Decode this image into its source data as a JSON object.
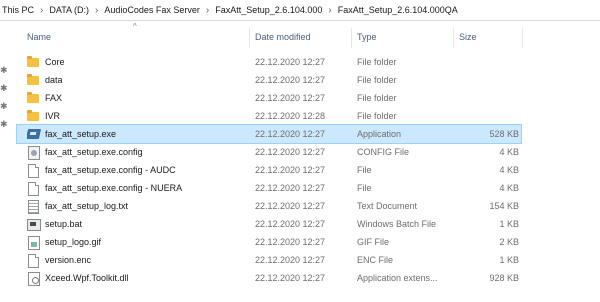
{
  "breadcrumb": [
    "This PC",
    "DATA (D:)",
    "AudioCodes Fax Server",
    "FaxAtt_Setup_2.6.104.000",
    "FaxAtt_Setup_2.6.104.000QA"
  ],
  "breadcrumb_separator": "›",
  "header": {
    "name": "Name",
    "date_modified": "Date modified",
    "type": "Type",
    "size": "Size",
    "sort_indicator": "^"
  },
  "pin_glyph": "✱",
  "files": [
    {
      "icon": "folder-icon",
      "name": "Core",
      "date": "22.12.2020 12:27",
      "type": "File folder",
      "size": ""
    },
    {
      "icon": "folder-icon",
      "name": "data",
      "date": "22.12.2020 12:27",
      "type": "File folder",
      "size": ""
    },
    {
      "icon": "folder-icon",
      "name": "FAX",
      "date": "22.12.2020 12:27",
      "type": "File folder",
      "size": ""
    },
    {
      "icon": "folder-icon",
      "name": "IVR",
      "date": "22.12.2020 12:28",
      "type": "File folder",
      "size": ""
    },
    {
      "icon": "application-icon",
      "name": "fax_att_setup.exe",
      "date": "22.12.2020 12:27",
      "type": "Application",
      "size": "528 KB",
      "selected": true
    },
    {
      "icon": "config-file-icon",
      "name": "fax_att_setup.exe.config",
      "date": "22.12.2020 12:27",
      "type": "CONFIG File",
      "size": "4 KB"
    },
    {
      "icon": "file-icon",
      "name": "fax_att_setup.exe.config - AUDC",
      "date": "22.12.2020 12:27",
      "type": "File",
      "size": "4 KB"
    },
    {
      "icon": "file-icon",
      "name": "fax_att_setup.exe.config - NUERA",
      "date": "22.12.2020 12:27",
      "type": "File",
      "size": "4 KB"
    },
    {
      "icon": "text-document-icon",
      "name": "fax_att_setup_log.txt",
      "date": "22.12.2020 12:27",
      "type": "Text Document",
      "size": "154 KB"
    },
    {
      "icon": "batch-file-icon",
      "name": "setup.bat",
      "date": "22.12.2020 12:27",
      "type": "Windows Batch File",
      "size": "1 KB"
    },
    {
      "icon": "gif-image-icon",
      "name": "setup_logo.gif",
      "date": "22.12.2020 12:27",
      "type": "GIF File",
      "size": "2 KB"
    },
    {
      "icon": "file-icon",
      "name": "version.enc",
      "date": "22.12.2020 12:27",
      "type": "ENC File",
      "size": "1 KB"
    },
    {
      "icon": "dll-file-icon",
      "name": "Xceed.Wpf.Toolkit.dll",
      "date": "22.12.2020 12:27",
      "type": "Application extens...",
      "size": "928 KB"
    }
  ]
}
